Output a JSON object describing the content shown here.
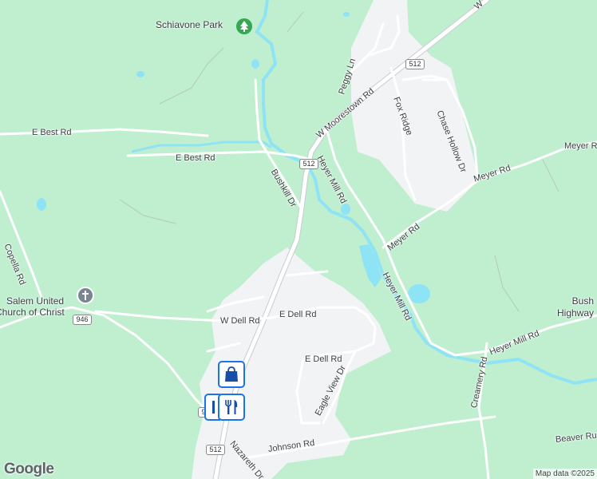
{
  "map": {
    "style": {
      "land": "#bfefcf",
      "urban": "#f1f3f4",
      "road": "#ffffff",
      "road_edge": "#c8ccd0",
      "water": "#8ee3f5",
      "label": "#3c4043",
      "pin_border": "#1a73e8",
      "pin_icon": "#174ea6"
    },
    "road_labels": [
      {
        "id": "w-moorestown-rd",
        "text": "W Moorestown Rd"
      },
      {
        "id": "e-best-rd-top",
        "text": "E Best Rd"
      },
      {
        "id": "e-best-rd",
        "text": "E Best Rd"
      },
      {
        "id": "bushkill-dr",
        "text": "Bushkill Dr"
      },
      {
        "id": "heyer-mill-rd-top",
        "text": "Heyer Mill Rd"
      },
      {
        "id": "heyer-mill-rd-mid",
        "text": "Heyer Mill Rd"
      },
      {
        "id": "heyer-mill-rd-right",
        "text": "Heyer Mill Rd"
      },
      {
        "id": "peggy-ln",
        "text": "Peggy Ln"
      },
      {
        "id": "fox-ridge",
        "text": "Fox Ridge"
      },
      {
        "id": "chase-hollow-dr",
        "text": "Chase Hollow Dr"
      },
      {
        "id": "meyer-rd-right",
        "text": "Meyer Rd"
      },
      {
        "id": "meyer-rd-mid",
        "text": "Meyer Rd"
      },
      {
        "id": "meyer-rd-low",
        "text": "Meyer Rd"
      },
      {
        "id": "copella-rd",
        "text": "Copella Rd"
      },
      {
        "id": "w-dell-rd",
        "text": "W Dell Rd"
      },
      {
        "id": "e-dell-rd",
        "text": "E Dell Rd"
      },
      {
        "id": "e-dell-rd-south",
        "text": "E Dell Rd"
      },
      {
        "id": "eagle-view-dr",
        "text": "Eagle View Dr"
      },
      {
        "id": "johnson-rd",
        "text": "Johnson Rd"
      },
      {
        "id": "nazareth-dr",
        "text": "Nazareth Dr"
      },
      {
        "id": "creamery-rd",
        "text": "Creamery Rd"
      },
      {
        "id": "beaver-run",
        "text": "Beaver Run"
      },
      {
        "id": "bushkill-highway",
        "text": "Bush\nHighway"
      },
      {
        "id": "w-top",
        "text": "W"
      }
    ],
    "route_shields": [
      {
        "id": "shield-512-top",
        "text": "512"
      },
      {
        "id": "shield-512-mid",
        "text": "512"
      },
      {
        "id": "shield-512-bottom",
        "text": "512"
      },
      {
        "id": "shield-946",
        "text": "946"
      },
      {
        "id": "shield-partial",
        "text": "9"
      }
    ],
    "pois": [
      {
        "id": "schiavone-park",
        "text": "Schiavone Park",
        "icon": "tree-icon"
      },
      {
        "id": "salem-united",
        "text": "Salem United\nChurch of Christ",
        "icon": "cross-icon"
      }
    ],
    "pins": [
      {
        "id": "shopping-pin",
        "icon": "shopping-bag-icon"
      },
      {
        "id": "restaurant-pin",
        "icon": "fork-knife-icon"
      },
      {
        "id": "partial-pin",
        "icon": "fork-knife-icon"
      }
    ],
    "google_logo": "Google",
    "attribution": "Map data ©2025"
  }
}
